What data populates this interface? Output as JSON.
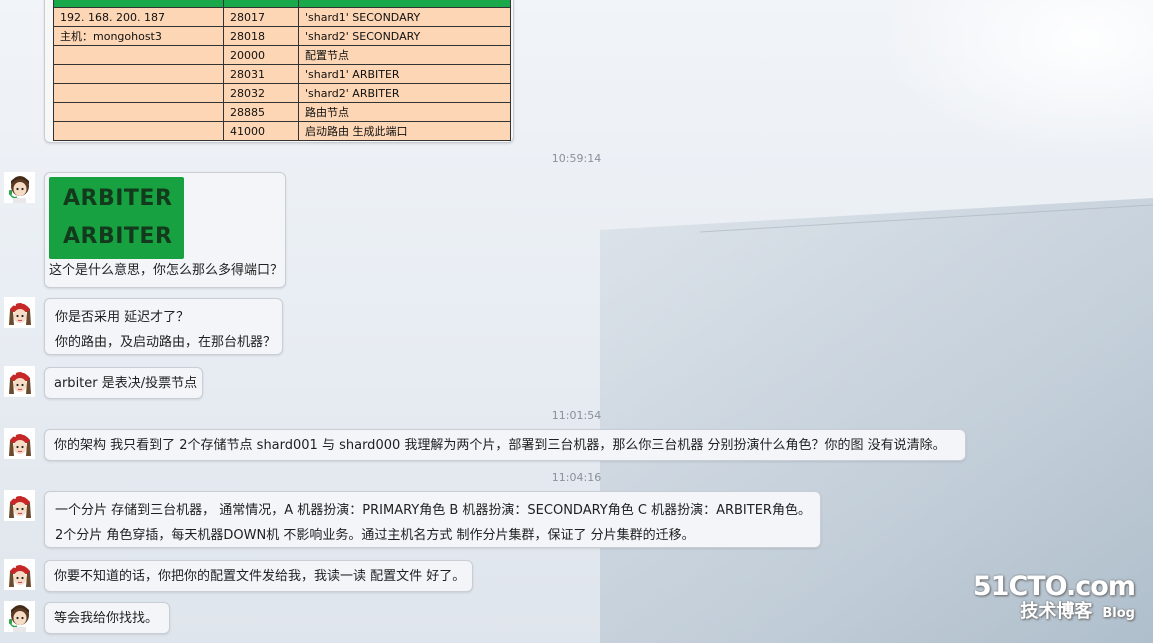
{
  "table": {
    "rows": [
      {
        "host": "192. 168. 200. 187",
        "port": "28017",
        "role": "'shard1'    SECONDARY"
      },
      {
        "host": "主机：mongohost3",
        "port": "28018",
        "role": "'shard2'    SECONDARY"
      },
      {
        "host": "",
        "port": "20000",
        "role": "配置节点"
      },
      {
        "host": "",
        "port": "28031",
        "role": "'shard1'    ARBITER"
      },
      {
        "host": "",
        "port": "28032",
        "role": "'shard2'    ARBITER"
      },
      {
        "host": "",
        "port": "28885",
        "role": "路由节点"
      },
      {
        "host": "",
        "port": "41000",
        "role": "启动路由  生成此端口"
      }
    ]
  },
  "timestamps": [
    "10:59:14",
    "11:01:54",
    "11:04:16"
  ],
  "messages": {
    "m1": {
      "image_lines": [
        "ARBITER",
        "ARBITER"
      ],
      "text": "这个是什么意思，你怎么那么多得端口？"
    },
    "m2": {
      "lines": [
        "你是否采用 延迟才了？",
        "你的路由，及启动路由，在那台机器？"
      ]
    },
    "m3": {
      "lines": [
        "arbiter 是表决/投票节点"
      ]
    },
    "m4": {
      "lines": [
        "你的架构 我只看到了 2个存储节点  shard001   与 shard000   我理解为两个片，部署到三台机器，那么你三台机器 分别扮演什么角色？你的图 没有说清除。"
      ]
    },
    "m5": {
      "lines": [
        "一个分片  存储到三台机器， 通常情况，A 机器扮演：PRIMARY角色  B 机器扮演：SECONDARY角色 C 机器扮演：ARBITER角色。",
        "2个分片 角色穿插，每天机器DOWN机 不影响业务。通过主机名方式 制作分片集群，保证了 分片集群的迁移。"
      ]
    },
    "m6": {
      "lines": [
        "你要不知道的话，你把你的配置文件发给我，我读一读 配置文件 好了。"
      ]
    },
    "m7": {
      "lines": [
        "等会我给你找找。"
      ]
    }
  },
  "watermark": {
    "top": "51CTO.com",
    "bottom": "技术博客",
    "blog": "Blog"
  },
  "colors": {
    "header_green": "#19a84a",
    "cell_peach": "#fdd6b5",
    "arbiter_green": "#17a141"
  }
}
